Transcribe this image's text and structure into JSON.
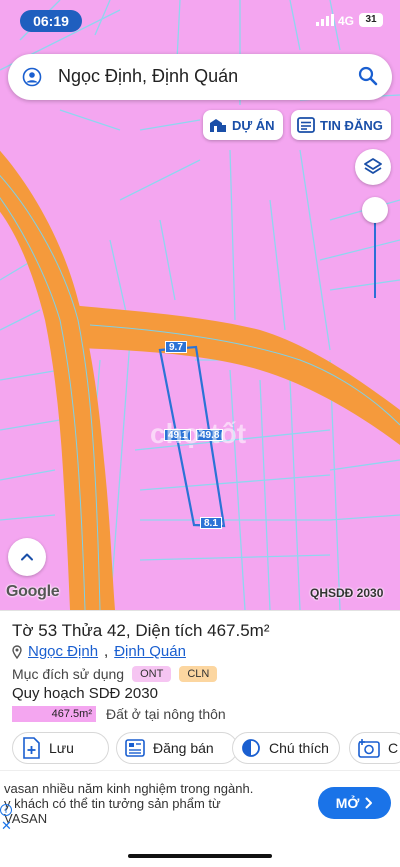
{
  "status_bar": {
    "time": "06:19",
    "network": "4G",
    "battery": "31"
  },
  "search": {
    "value": "Ngọc Định, Định Quán"
  },
  "map_buttons": {
    "du_an": "DỰ ÁN",
    "tin_dang": "TIN ĐĂNG"
  },
  "map": {
    "edge_labels": [
      "9.7",
      "49.1",
      "49.8",
      "8.1"
    ],
    "attribution": "Google",
    "layer_label": "QHSDĐ 2030",
    "watermark": "chợ tốt"
  },
  "parcel": {
    "title": "Tờ 53 Thửa 42, Diện tích 467.5m²",
    "location_parts": [
      "Ngọc Định",
      "Định Quán"
    ],
    "purpose_label": "Mục đích sử dụng",
    "purpose_tags": [
      "ONT",
      "CLN"
    ],
    "plan_label": "Quy hoạch SDĐ 2030",
    "plan_area": "467.5m²",
    "plan_desc": "Đất ở tại nông thôn"
  },
  "actions": {
    "save": "Lưu",
    "sell": "Đăng bán",
    "note": "Chú thích",
    "more": "C"
  },
  "ad": {
    "line1": "vasan nhiều năm kinh nghiệm trong ngành.",
    "line2": "y khách có thể tin tưởng sản phẩm từ",
    "line3": "VASAN",
    "cta": "MỞ"
  },
  "colors": {
    "land_pink": "#f4a6f0",
    "road_orange": "#f59a3c",
    "accent_blue": "#1a73e8",
    "parcel_blue": "#2b73d6"
  }
}
